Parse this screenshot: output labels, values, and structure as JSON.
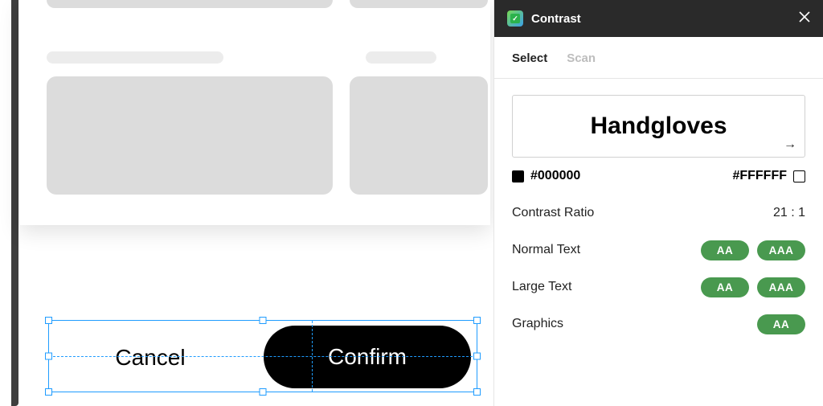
{
  "canvas": {
    "cancel_label": "Cancel",
    "confirm_label": "Confirm"
  },
  "panel": {
    "title": "Contrast",
    "tabs": {
      "select": "Select",
      "scan": "Scan"
    },
    "preview_text": "Handgloves",
    "fg_color": "#000000",
    "bg_color": "#FFFFFF",
    "metrics": {
      "ratio_label": "Contrast Ratio",
      "ratio_value": "21 : 1",
      "normal_label": "Normal Text",
      "normal_aa": "AA",
      "normal_aaa": "AAA",
      "large_label": "Large Text",
      "large_aa": "AA",
      "large_aaa": "AAA",
      "graphics_label": "Graphics",
      "graphics_aa": "AA"
    }
  }
}
